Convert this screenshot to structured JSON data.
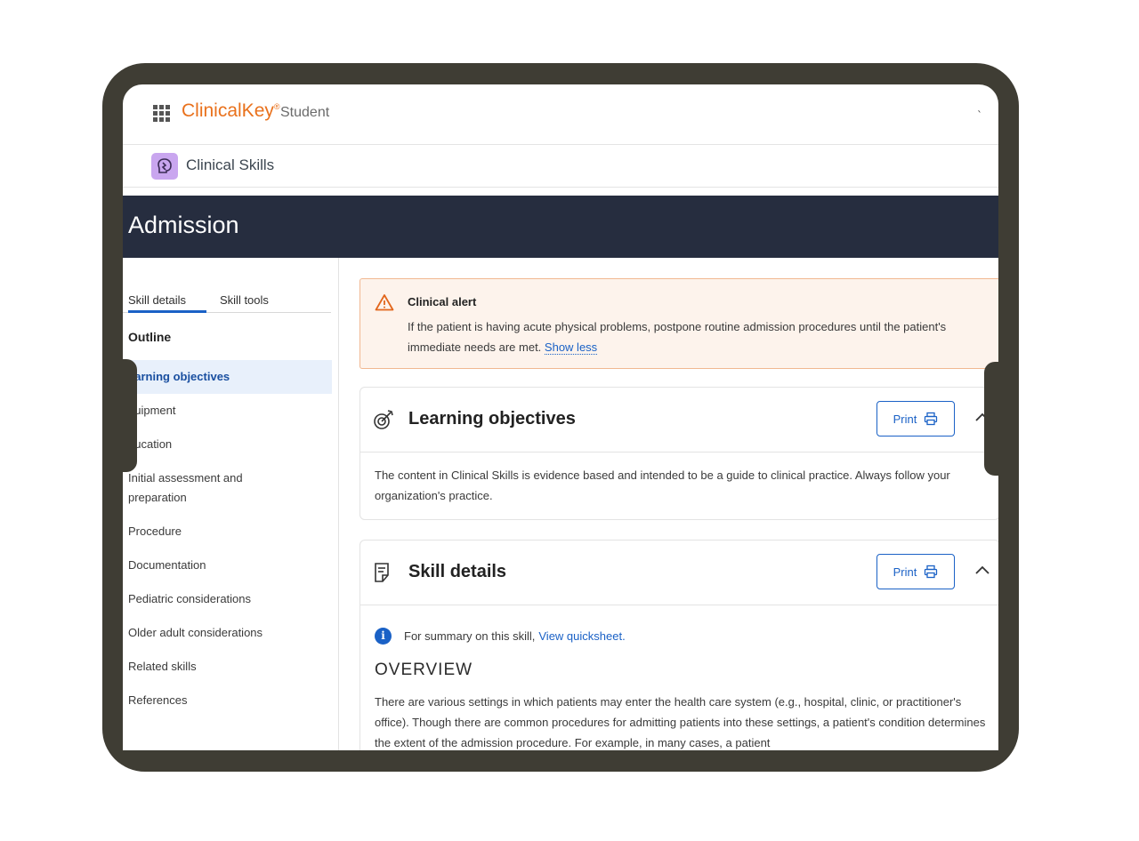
{
  "header": {
    "brand": "ClinicalKey",
    "brand_reg": "®",
    "brand_sub": "Student",
    "tick": "`"
  },
  "subheader": {
    "app_name": "Clinical Skills"
  },
  "banner": {
    "title": "Admission"
  },
  "leftnav": {
    "tabs": [
      {
        "label": "Skill details",
        "active": true
      },
      {
        "label": "Skill tools",
        "active": false
      }
    ],
    "outline_title": "Outline",
    "items": [
      {
        "label": "earning objectives",
        "active": true
      },
      {
        "label": "quipment"
      },
      {
        "label": "ducation"
      },
      {
        "label": "Initial assessment and preparation"
      },
      {
        "label": "Procedure"
      },
      {
        "label": "Documentation"
      },
      {
        "label": "Pediatric considerations"
      },
      {
        "label": "Older adult considerations"
      },
      {
        "label": "Related skills"
      },
      {
        "label": "References"
      }
    ]
  },
  "alert": {
    "title": "Clinical alert",
    "text": "If the patient is having acute physical problems, postpone routine admission procedures until the patient's immediate needs are met.",
    "link": "Show less"
  },
  "cards": {
    "learning": {
      "title": "Learning objectives",
      "print_label": "Print",
      "body": "The content in Clinical Skills is evidence based and intended to be a guide to clinical practice. Always follow your organization's practice."
    },
    "skill": {
      "title": "Skill details",
      "print_label": "Print",
      "info_text": "For summary on this skill,",
      "info_link": "View quicksheet.",
      "overview_title": "OVERVIEW",
      "overview_text": "There are various settings in which patients may enter the health care system (e.g., hospital, clinic, or practitioner's office). Though there are common procedures for admitting patients into these settings, a patient's condition determines the extent of the admission procedure. For example, in many cases, a patient"
    }
  },
  "colors": {
    "brand_orange": "#e9711c",
    "banner_navy": "#262d3f",
    "link_blue": "#1a61c6",
    "alert_bg": "#fdf3ec",
    "alert_border": "#f1b891",
    "device_frame": "#3f3d34"
  }
}
